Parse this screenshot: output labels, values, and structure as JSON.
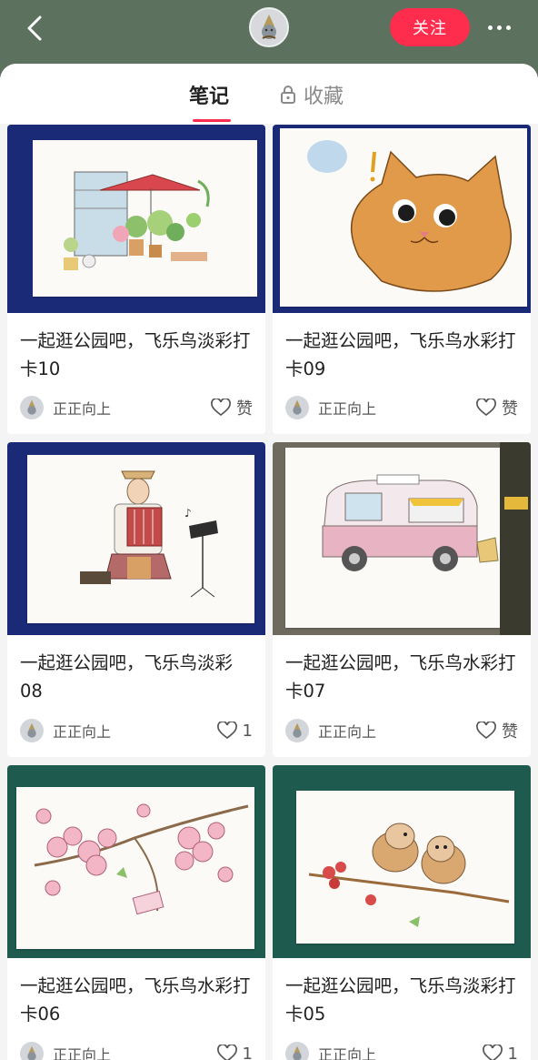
{
  "header": {
    "follow_label": "关注"
  },
  "tabs": [
    {
      "label": "笔记",
      "active": true
    },
    {
      "label": "收藏",
      "active": false,
      "icon": "lock-icon"
    }
  ],
  "notes": [
    {
      "title": "一起逛公园吧，飞乐鸟淡彩打卡10",
      "author": "正正向上",
      "likes": "赞",
      "image": "garden-cafe-watercolor"
    },
    {
      "title": "一起逛公园吧，飞乐鸟水彩打卡09",
      "author": "正正向上",
      "likes": "赞",
      "image": "cat-watercolor"
    },
    {
      "title": "一起逛公园吧，飞乐鸟淡彩08",
      "author": "正正向上",
      "likes": "1",
      "image": "accordion-player-watercolor"
    },
    {
      "title": "一起逛公园吧，飞乐鸟水彩打卡07",
      "author": "正正向上",
      "likes": "赞",
      "image": "ice-cream-van-watercolor"
    },
    {
      "title": "一起逛公园吧，飞乐鸟水彩打卡06",
      "author": "正正向上",
      "likes": "1",
      "image": "cherry-blossom-watercolor"
    },
    {
      "title": "一起逛公园吧，飞乐鸟淡彩打卡05",
      "author": "正正向上",
      "likes": "1",
      "image": "birds-on-branch-watercolor"
    }
  ],
  "colors": {
    "header_bg": "#5c715e",
    "accent": "#ff2d4d",
    "feed_bg": "#f4f4f4"
  }
}
